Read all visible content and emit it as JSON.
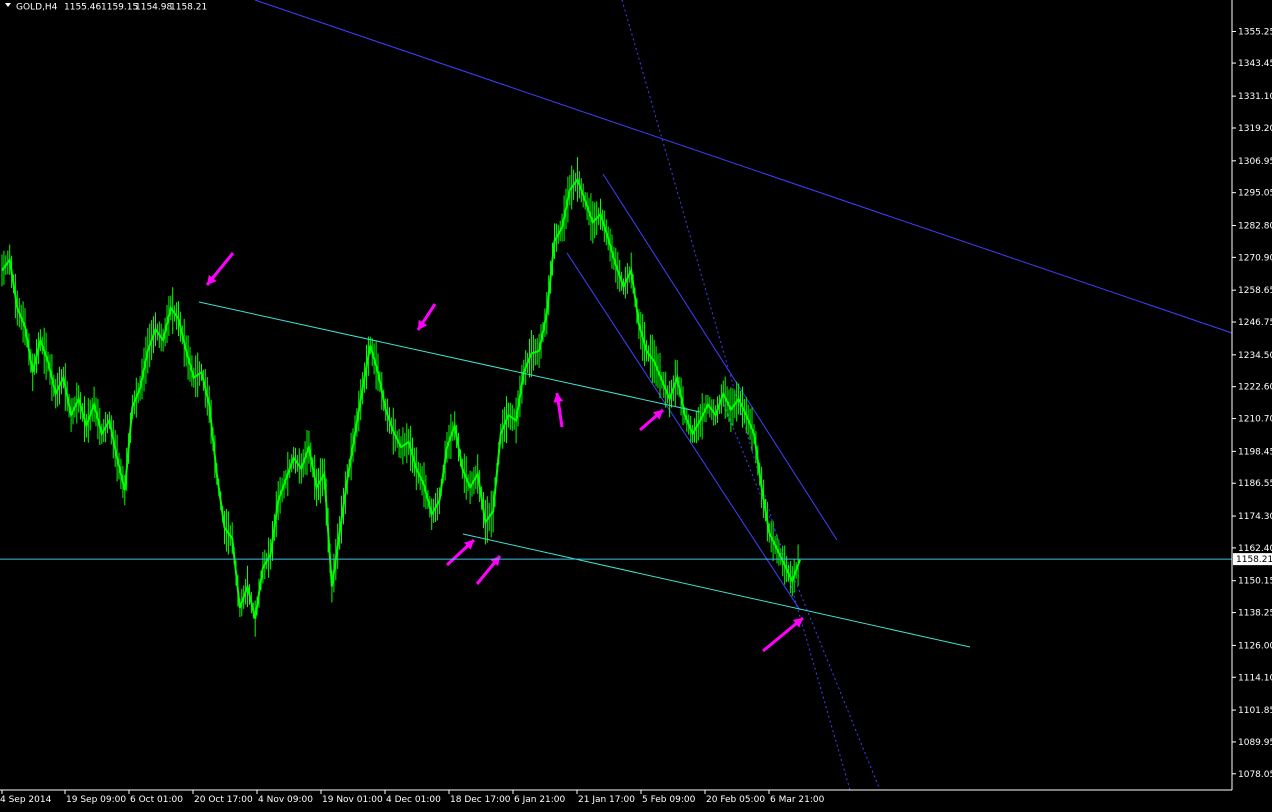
{
  "header": {
    "symbol": "GOLD,H4",
    "open": "1155.46",
    "high": "1159.15",
    "low": "1154.98",
    "close": "1158.21"
  },
  "current_price": 1158.21,
  "current_price_label": "1158.21",
  "colors": {
    "background": "#000000",
    "candles": "#00ff00",
    "channel": "#40e0d0",
    "trendlines": "#4040ff",
    "arrows": "#ff00ff",
    "axis": "#ffffff",
    "price_line": "#40c0e0"
  },
  "chart_data": {
    "type": "line",
    "title": "",
    "xlabel": "",
    "ylabel": "",
    "ylim": [
      1072.0,
      1367.0
    ],
    "grid": false,
    "y_ticks": [
      "1355.25",
      "1343.45",
      "1331.10",
      "1319.20",
      "1306.95",
      "1295.05",
      "1282.80",
      "1270.90",
      "1258.65",
      "1246.75",
      "1234.50",
      "1222.60",
      "1210.70",
      "1198.45",
      "1186.55",
      "1174.30",
      "1162.40",
      "1150.15",
      "1138.25",
      "1126.00",
      "1114.10",
      "1101.85",
      "1089.95",
      "1078.05"
    ],
    "x_ticks": [
      "4 Sep 2014",
      "19 Sep 09:00",
      "6 Oct 01:00",
      "20 Oct 17:00",
      "4 Nov 09:00",
      "19 Nov 01:00",
      "4 Dec 01:00",
      "18 Dec 17:00",
      "6 Jan 21:00",
      "21 Jan 17:00",
      "5 Feb 09:00",
      "20 Feb 05:00",
      "6 Mar 21:00"
    ],
    "series": [
      {
        "values": [
          1266,
          1270,
          1252,
          1245,
          1228,
          1240,
          1232,
          1220,
          1226,
          1212,
          1218,
          1208,
          1216,
          1205,
          1210,
          1196,
          1184,
          1215,
          1222,
          1236,
          1244,
          1240,
          1252,
          1248,
          1236,
          1226,
          1228,
          1216,
          1190,
          1170,
          1166,
          1140,
          1148,
          1136,
          1155,
          1160,
          1180,
          1188,
          1196,
          1192,
          1200,
          1185,
          1190,
          1148,
          1168,
          1188,
          1205,
          1222,
          1238,
          1228,
          1214,
          1206,
          1200,
          1202,
          1192,
          1186,
          1175,
          1180,
          1200,
          1208,
          1192,
          1185,
          1190,
          1172,
          1176,
          1205,
          1212,
          1210,
          1228,
          1235,
          1236,
          1250,
          1277,
          1282,
          1296,
          1300,
          1292,
          1284,
          1287,
          1278,
          1268,
          1260,
          1266,
          1246,
          1236,
          1232,
          1225,
          1218,
          1226,
          1212,
          1205,
          1210,
          1216,
          1212,
          1220,
          1214,
          1218,
          1212,
          1205,
          1185,
          1168,
          1162,
          1156,
          1150,
          1158
        ]
      }
    ],
    "annotations": {
      "channel_upper": [
        [
          0.4,
          1257
        ],
        [
          0.82,
          1219
        ]
      ],
      "channel_lower": [
        [
          0.46,
          1169
        ],
        [
          1.0,
          1130
        ]
      ],
      "arrow_count": 8
    }
  }
}
